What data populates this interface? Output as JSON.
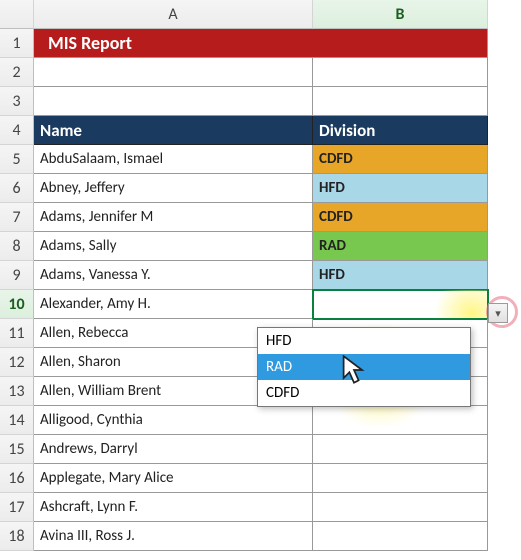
{
  "columns": {
    "A": "A",
    "B": "B"
  },
  "title": "MIS Report",
  "headers": {
    "name": "Name",
    "division": "Division"
  },
  "active_row": "10",
  "rows": [
    {
      "n": "1"
    },
    {
      "n": "2"
    },
    {
      "n": "3"
    },
    {
      "n": "4"
    },
    {
      "n": "5",
      "name": "AbduSalaam, Ismael",
      "division": "CDFD",
      "cls": "div-cdfd"
    },
    {
      "n": "6",
      "name": "Abney, Jeffery",
      "division": "HFD",
      "cls": "div-hfd"
    },
    {
      "n": "7",
      "name": "Adams, Jennifer M",
      "division": "CDFD",
      "cls": "div-cdfd"
    },
    {
      "n": "8",
      "name": "Adams, Sally",
      "division": "RAD",
      "cls": "div-rad"
    },
    {
      "n": "9",
      "name": "Adams, Vanessa Y.",
      "division": "HFD",
      "cls": "div-hfd"
    },
    {
      "n": "10",
      "name": "Alexander, Amy H.",
      "division": ""
    },
    {
      "n": "11",
      "name": "Allen, Rebecca",
      "division": ""
    },
    {
      "n": "12",
      "name": "Allen, Sharon",
      "division": ""
    },
    {
      "n": "13",
      "name": "Allen, William Brent",
      "division": ""
    },
    {
      "n": "14",
      "name": "Alligood, Cynthia",
      "division": ""
    },
    {
      "n": "15",
      "name": "Andrews, Darryl",
      "division": ""
    },
    {
      "n": "16",
      "name": "Applegate, Mary Alice",
      "division": ""
    },
    {
      "n": "17",
      "name": "Ashcraft, Lynn F.",
      "division": ""
    },
    {
      "n": "18",
      "name": "Avina III, Ross J.",
      "division": ""
    }
  ],
  "dropdown": {
    "options": [
      "HFD",
      "RAD",
      "CDFD"
    ],
    "selected": "RAD"
  }
}
